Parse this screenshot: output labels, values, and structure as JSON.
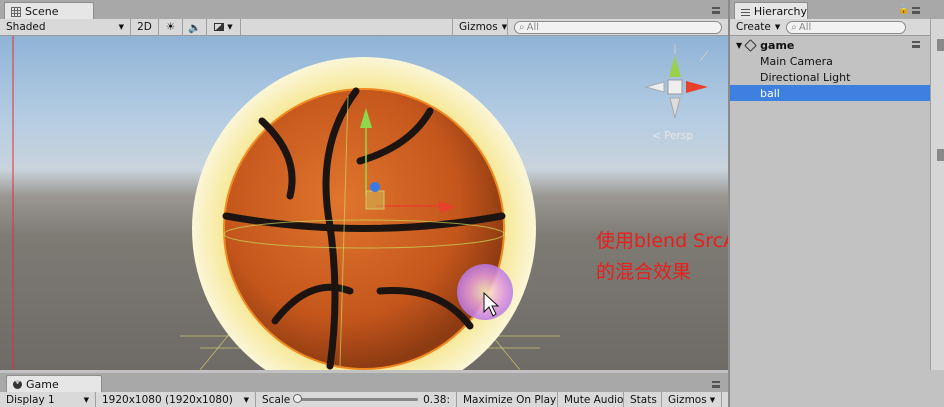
{
  "scene_tab": {
    "title": "Scene"
  },
  "scene_toolbar": {
    "draw_mode": "Shaded",
    "mode_2d": "2D",
    "gizmos": "Gizmos",
    "search_placeholder": "All"
  },
  "scene_view": {
    "persp_label": "Persp",
    "annotation_line1": "使用blend SrcAlpha One后",
    "annotation_line2": "的混合效果",
    "annotation_color": "#e8201c"
  },
  "hierarchy": {
    "tab_title": "Hierarchy",
    "create_label": "Create",
    "search_placeholder": "All",
    "scene_name": "game",
    "items": [
      {
        "label": "Main Camera",
        "selected": false
      },
      {
        "label": "Directional Light",
        "selected": false
      },
      {
        "label": "ball",
        "selected": true
      }
    ],
    "selection_color": "#3d80df"
  },
  "game_tab": {
    "title": "Game"
  },
  "game_toolbar": {
    "display": "Display 1",
    "resolution": "1920x1080 (1920x1080)",
    "scale_label": "Scale",
    "scale_value": "0.38:",
    "maximize": "Maximize On Play",
    "mute": "Mute Audio",
    "stats": "Stats",
    "gizmos": "Gizmos"
  }
}
